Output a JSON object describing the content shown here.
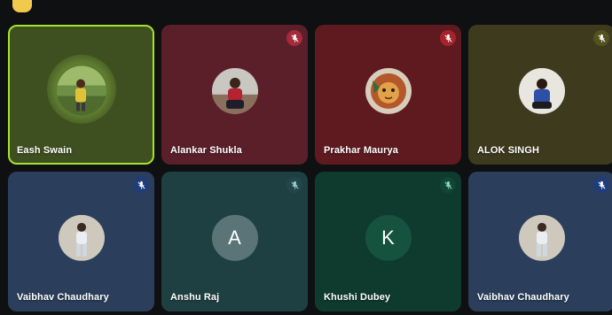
{
  "colors": {
    "background": "#0f1012",
    "active_border": "#a6e22e",
    "top_chip": "#f2c94c"
  },
  "participants": [
    {
      "name": "Eash Swain",
      "active_speaker": true,
      "bg": "#3f5020",
      "avatar": "photo-outdoor",
      "muted": false
    },
    {
      "name": "Alankar Shukla",
      "active_speaker": false,
      "bg": "#5b1f2a",
      "avatar": "photo-man-red",
      "muted": true,
      "mute_bg": "#a62a3a"
    },
    {
      "name": "Prakhar Maurya",
      "active_speaker": false,
      "bg": "#5e1a1f",
      "avatar": "photo-lion",
      "muted": true,
      "mute_bg": "#a6232c"
    },
    {
      "name": "ALOK SINGH",
      "active_speaker": false,
      "bg": "#3d3a1e",
      "avatar": "photo-man-blue",
      "muted": true,
      "mute_bg": "#55521f"
    },
    {
      "name": "Vaibhav Chaudhary",
      "active_speaker": false,
      "bg": "#2b3f5c",
      "avatar": "photo-man-white",
      "muted": true,
      "mute_bg": "#1f3d7a"
    },
    {
      "name": "Anshu Raj",
      "active_speaker": false,
      "bg": "#1f4043",
      "avatar_letter": "A",
      "avatar_color": "#5a7477",
      "muted": true,
      "mute_bg": "#23464a"
    },
    {
      "name": "Khushi Dubey",
      "active_speaker": false,
      "bg": "#0f3a2e",
      "avatar_letter": "K",
      "avatar_color": "#15533f",
      "muted": true,
      "mute_bg": "#124535"
    },
    {
      "name": "Vaibhav Chaudhary",
      "active_speaker": false,
      "bg": "#2b3f5c",
      "avatar": "photo-man-white",
      "muted": true,
      "mute_bg": "#1f3d7a"
    }
  ]
}
